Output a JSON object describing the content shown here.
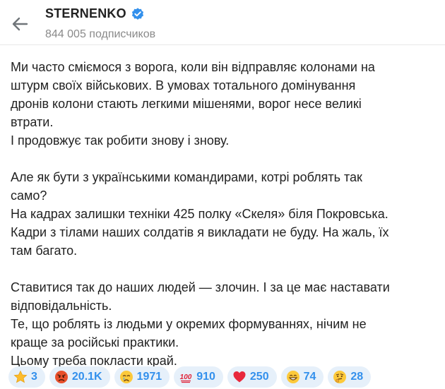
{
  "header": {
    "title": "STERNENKO",
    "subscribers": "844 005 подписчиков"
  },
  "post": {
    "lines": [
      "Ми часто сміємося з ворога, коли він відправляє колонами на",
      "штурм своїх військових. В умовах тотального домінування",
      "дронів колони стають легкими мішенями, ворог несе великі",
      "втрати.",
      "І продовжує так робити знову і знову.",
      "",
      "Але як бути з українськими командирами, котрі роблять так",
      "само?",
      "На кадрах залишки техніки 425 полку «Скеля» біля Покровська.",
      "Кадри з тілами наших солдатів я викладати не буду. На жаль, їх",
      "там багато.",
      "",
      "Ставитися так до наших людей — злочин. І за це має наставати",
      "відповідальність.",
      "Те, що роблять із людьми у окремих формуваннях, нічим не",
      "краще за російські практики.",
      "Цьому треба покласти край."
    ]
  },
  "reactions": [
    {
      "icon": "star-icon",
      "count": "3"
    },
    {
      "icon": "angry-face-icon",
      "count": "20.1K"
    },
    {
      "icon": "crying-face-icon",
      "count": "1971"
    },
    {
      "icon": "hundred-points-icon",
      "count": "910"
    },
    {
      "icon": "red-heart-icon",
      "count": "250"
    },
    {
      "icon": "grinning-face-icon",
      "count": "74"
    },
    {
      "icon": "thinking-face-icon",
      "count": "28"
    }
  ],
  "colors": {
    "accent": "#3390ec",
    "chip_background": "#e6f0fa",
    "verified": "#3390ec",
    "secondary_text": "#8a8a8a"
  }
}
